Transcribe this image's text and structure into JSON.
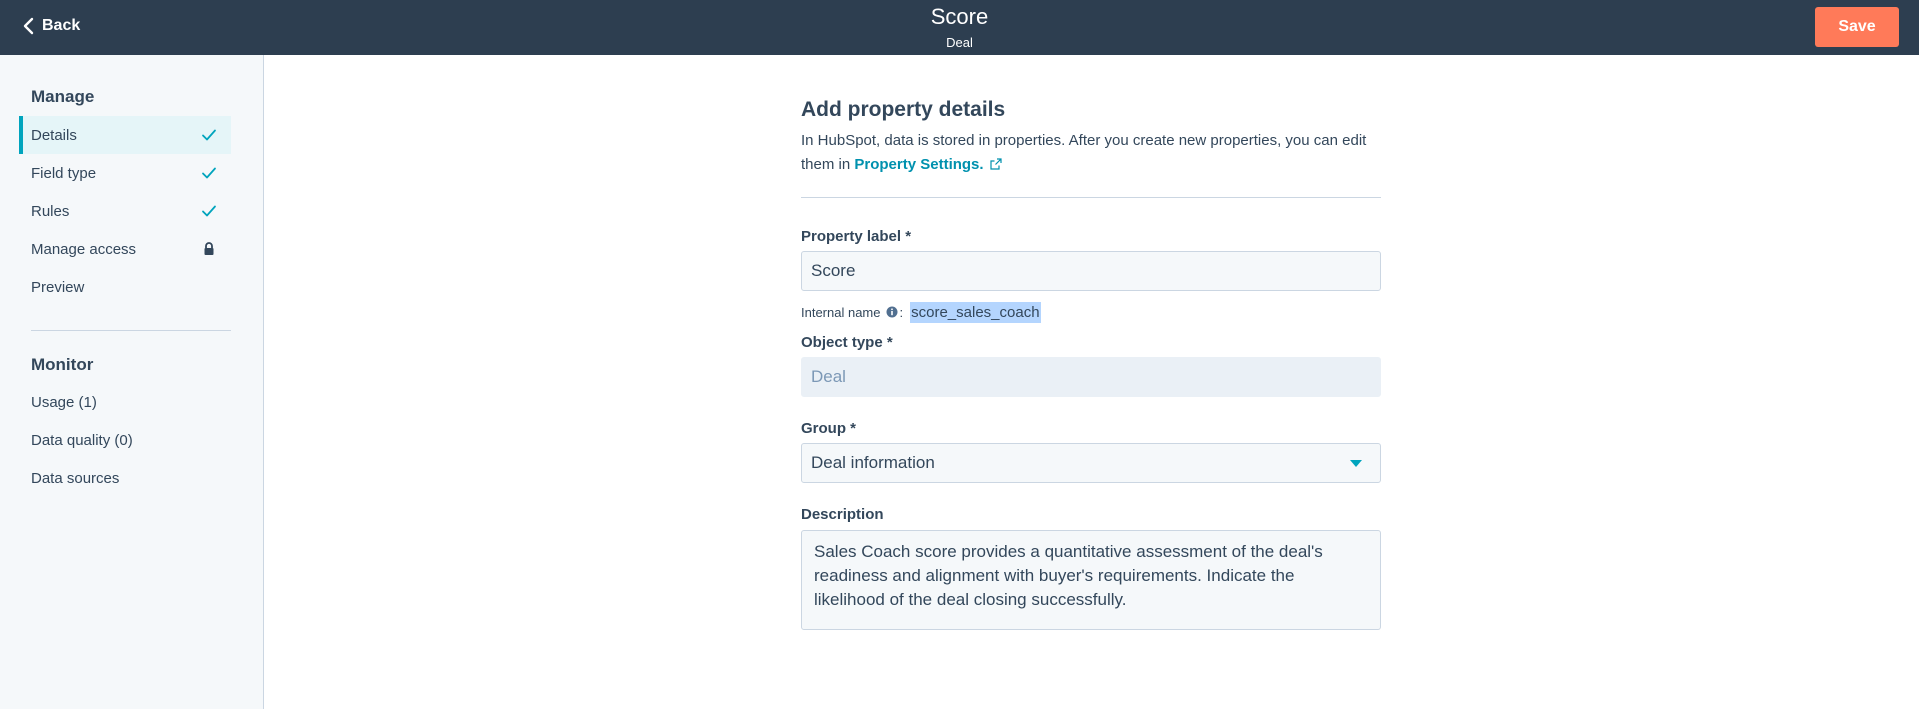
{
  "header": {
    "back_label": "Back",
    "title": "Score",
    "subtitle": "Deal",
    "save_label": "Save"
  },
  "sidebar": {
    "manage_title": "Manage",
    "manage_items": [
      {
        "label": "Details",
        "icon": "check-icon",
        "active": true
      },
      {
        "label": "Field type",
        "icon": "check-icon"
      },
      {
        "label": "Rules",
        "icon": "check-icon"
      },
      {
        "label": "Manage access",
        "icon": "lock-icon"
      },
      {
        "label": "Preview"
      }
    ],
    "monitor_title": "Monitor",
    "monitor_items": [
      {
        "label": "Usage (1)"
      },
      {
        "label": "Data quality (0)"
      },
      {
        "label": "Data sources"
      }
    ]
  },
  "form": {
    "heading": "Add property details",
    "intro_text": "In HubSpot, data is stored in properties. After you create new properties, you can edit them in",
    "intro_link": "Property Settings.",
    "property_label": {
      "label": "Property label *",
      "value": "Score"
    },
    "internal_name": {
      "label": "Internal name",
      "value": "score_sales_coach"
    },
    "object_type": {
      "label": "Object type *",
      "value": "Deal"
    },
    "group": {
      "label": "Group *",
      "value": "Deal information"
    },
    "description": {
      "label": "Description",
      "value": "Sales Coach score provides a quantitative assessment of the deal's readiness and alignment with buyer's requirements. Indicate the likelihood of the deal closing successfully."
    }
  },
  "colors": {
    "header_bg": "#2d3e50",
    "accent": "#ff7a59",
    "teal": "#00a4bd",
    "link": "#0091ae"
  }
}
